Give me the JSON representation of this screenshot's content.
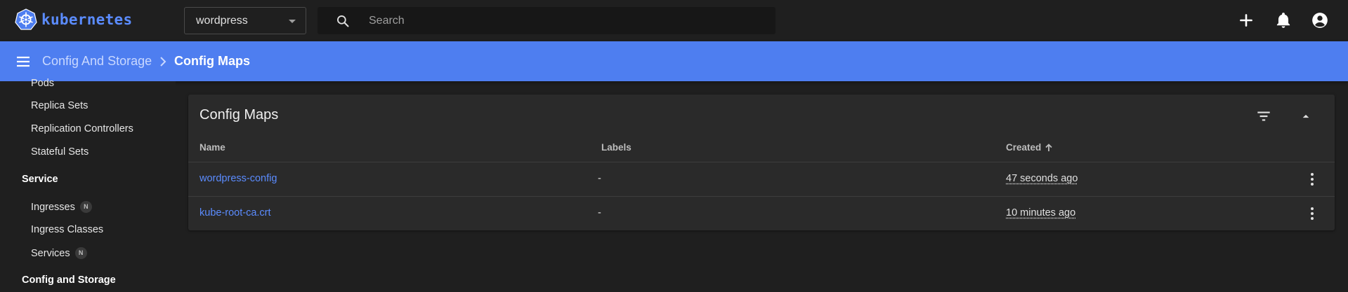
{
  "brand": {
    "name": "kubernetes",
    "color": "#5b8cff"
  },
  "namespace": {
    "selected": "wordpress"
  },
  "search": {
    "placeholder": "Search",
    "value": ""
  },
  "topbar": {
    "icons": [
      "add-icon",
      "bell-icon",
      "account-circle-icon"
    ]
  },
  "breadcrumb": {
    "parent": "Config And Storage",
    "current": "Config Maps"
  },
  "sidebar": {
    "workloads_items": [
      {
        "label": "Pods"
      },
      {
        "label": "Replica Sets"
      },
      {
        "label": "Replication Controllers"
      },
      {
        "label": "Stateful Sets"
      }
    ],
    "service_section": "Service",
    "service_items": [
      {
        "label": "Ingresses",
        "badge": "N"
      },
      {
        "label": "Ingress Classes"
      },
      {
        "label": "Services",
        "badge": "N"
      }
    ],
    "config_section": "Config and Storage"
  },
  "card": {
    "title": "Config Maps",
    "columns": {
      "name": "Name",
      "labels": "Labels",
      "created": "Created"
    },
    "rows": [
      {
        "name": "wordpress-config",
        "labels": "-",
        "created": "47 seconds ago"
      },
      {
        "name": "kube-root-ca.crt",
        "labels": "-",
        "created": "10 minutes ago"
      }
    ]
  },
  "colors": {
    "accent": "#4e7ef0",
    "link": "#5b8cff",
    "background": "#1f1f1f",
    "card": "#2a2a2a"
  }
}
